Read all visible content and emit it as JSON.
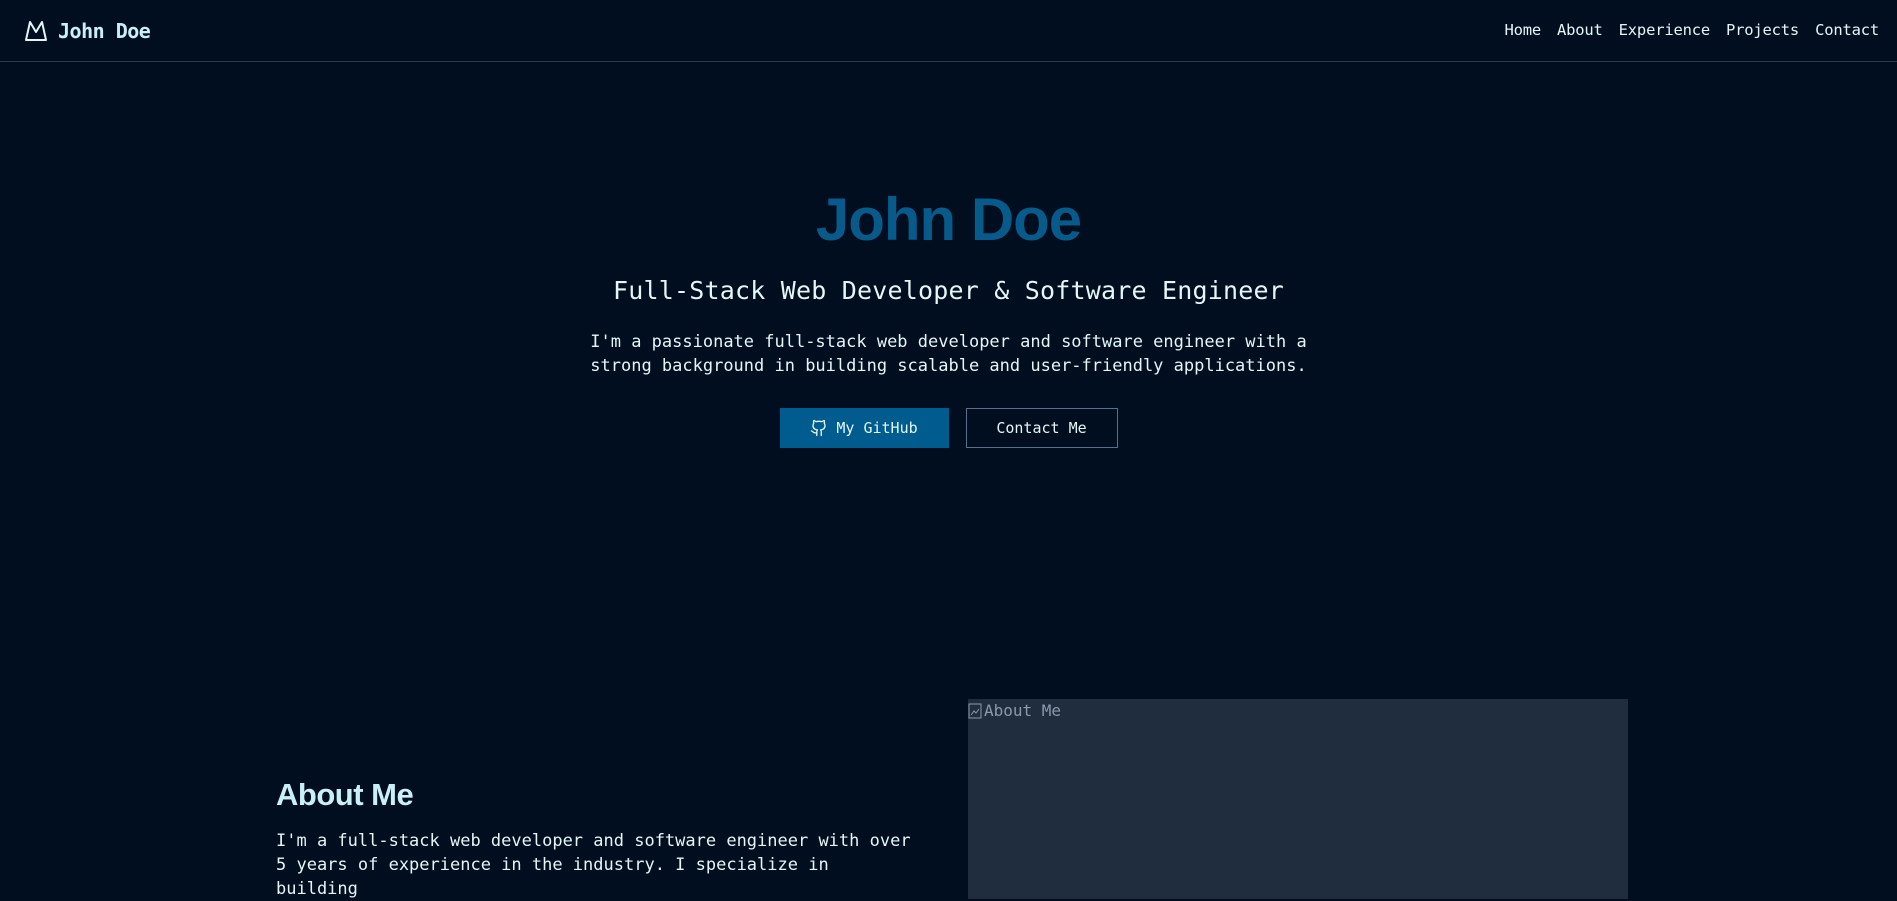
{
  "header": {
    "brand_name": "John Doe",
    "brand_icon": "mountain-icon",
    "nav": [
      {
        "label": "Home"
      },
      {
        "label": "About"
      },
      {
        "label": "Experience"
      },
      {
        "label": "Projects"
      },
      {
        "label": "Contact"
      }
    ]
  },
  "hero": {
    "title": "John Doe",
    "subtitle": "Full-Stack Web Developer & Software Engineer",
    "description": "I'm a passionate full-stack web developer and software engineer with a strong background in building scalable and user-friendly applications.",
    "primary_button": {
      "label": "My GitHub",
      "icon": "github-icon"
    },
    "secondary_button": {
      "label": "Contact Me"
    }
  },
  "about": {
    "title": "About Me",
    "text": "I'm a full-stack web developer and software engineer with over 5 years of experience in the industry. I specialize in building",
    "image_alt": "About Me"
  },
  "colors": {
    "background": "#000e1f",
    "accent": "#005b8e",
    "hero_title": "#075a8a",
    "text": "#e3f6f8",
    "image_placeholder": "#1f2d3e",
    "border": "#2a3a4c"
  }
}
